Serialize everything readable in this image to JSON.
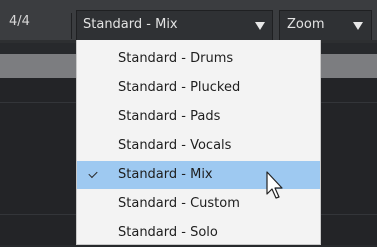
{
  "toolbar": {
    "time_signature": "4/4",
    "preset_value": "Standard - Mix",
    "zoom_value": "Zoom"
  },
  "menu": {
    "items": [
      {
        "label": "Standard - Drums"
      },
      {
        "label": "Standard - Plucked"
      },
      {
        "label": "Standard - Pads"
      },
      {
        "label": "Standard - Vocals"
      },
      {
        "label": "Standard - Mix",
        "checked": true
      },
      {
        "label": "Standard - Custom"
      },
      {
        "label": "Standard - Solo"
      }
    ]
  },
  "icons": {
    "preset_dropdown": "chevron-down-icon",
    "zoom_dropdown": "chevron-down-icon",
    "selected_marker": "checkmark-icon",
    "pointer": "mouse-cursor-icon"
  },
  "colors": {
    "toolbar_bg": "#3b3d40",
    "menu_bg": "#f3f3f3",
    "selected_bg": "#9ec9f1",
    "text_dark": "#1e1e1e"
  }
}
